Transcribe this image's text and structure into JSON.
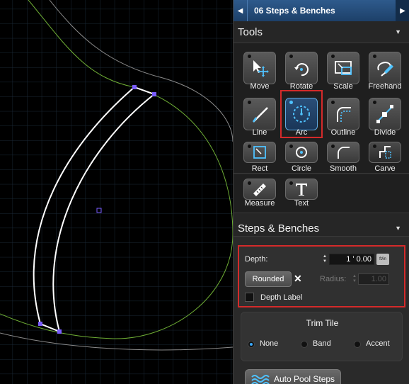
{
  "header": {
    "title": "06 Steps & Benches",
    "nav_left": "◀",
    "nav_right": "▶"
  },
  "tools_section": {
    "title": "Tools",
    "chevron": "▼",
    "items": [
      {
        "label": "Move",
        "icon": "move-icon"
      },
      {
        "label": "Rotate",
        "icon": "rotate-icon"
      },
      {
        "label": "Scale",
        "icon": "scale-icon"
      },
      {
        "label": "Freehand",
        "icon": "freehand-icon"
      },
      {
        "label": "Line",
        "icon": "line-icon"
      },
      {
        "label": "Arc",
        "icon": "arc-icon",
        "active": true
      },
      {
        "label": "Outline",
        "icon": "outline-icon"
      },
      {
        "label": "Divide",
        "icon": "divide-icon"
      },
      {
        "label": "Rect",
        "icon": "rect-icon"
      },
      {
        "label": "Circle",
        "icon": "circle-icon"
      },
      {
        "label": "Smooth",
        "icon": "smooth-icon"
      },
      {
        "label": "Carve",
        "icon": "carve-icon"
      },
      {
        "label": "Measure",
        "icon": "measure-icon"
      },
      {
        "label": "Text",
        "icon": "text-icon"
      }
    ]
  },
  "steps_section": {
    "title": "Steps & Benches",
    "chevron": "▼",
    "depth_label": "Depth:",
    "depth_value": "1 ' 0.00",
    "depth_unit": "ft/in",
    "rounded_label": "Rounded",
    "x_label": "✕",
    "radius_label": "Radius:",
    "radius_value": "1.00",
    "depth_label_check": "Depth Label",
    "trim_title": "Trim Tile",
    "trim_options": [
      "None",
      "Band",
      "Accent"
    ],
    "trim_selected": "None",
    "auto_button": "Auto Pool Steps"
  },
  "colors": {
    "accent": "#3aa9ff",
    "highlight": "#d42a2a",
    "header_blue": "#244f80",
    "grid": "#1c2b3a",
    "curve_green": "#7fc23a"
  }
}
